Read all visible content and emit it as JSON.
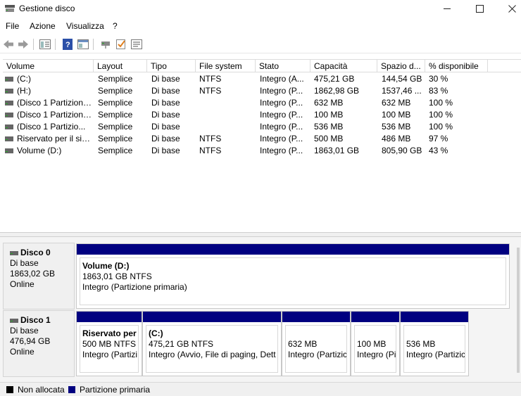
{
  "window": {
    "title": "Gestione disco",
    "controls": {
      "minimize": "—",
      "maximize": "☐",
      "close": "✕"
    }
  },
  "menu": [
    "File",
    "Azione",
    "Visualizza",
    "?"
  ],
  "toolbar": [
    "back-icon",
    "forward-icon",
    "properties-icon",
    "help-icon",
    "toggle-pane-icon",
    "connect-icon",
    "check-icon",
    "settings-icon"
  ],
  "columns": [
    "Volume",
    "Layout",
    "Tipo",
    "File system",
    "Stato",
    "Capacità",
    "Spazio d...",
    "% disponibile"
  ],
  "volumes": [
    [
      "(C:)",
      "Semplice",
      "Di base",
      "NTFS",
      "Integro (A...",
      "475,21 GB",
      "144,54 GB",
      "30 %"
    ],
    [
      "(H:)",
      "Semplice",
      "Di base",
      "NTFS",
      "Integro (P...",
      "1862,98 GB",
      "1537,46 ...",
      "83 %"
    ],
    [
      "(Disco 1 Partizione...",
      "Semplice",
      "Di base",
      "",
      "Integro (P...",
      "632 MB",
      "632 MB",
      "100 %"
    ],
    [
      "(Disco 1 Partizione...",
      "Semplice",
      "Di base",
      "",
      "Integro (P...",
      "100 MB",
      "100 MB",
      "100 %"
    ],
    [
      "(Disco 1 Partizio...",
      "Semplice",
      "Di base",
      "",
      "Integro (P...",
      "536 MB",
      "536 MB",
      "100 %"
    ],
    [
      "Riservato per il sist...",
      "Semplice",
      "Di base",
      "NTFS",
      "Integro (P...",
      "500 MB",
      "486 MB",
      "97 %"
    ],
    [
      "Volume (D:)",
      "Semplice",
      "Di base",
      "NTFS",
      "Integro (P...",
      "1863,01 GB",
      "805,90 GB",
      "43 %"
    ]
  ],
  "disks": [
    {
      "name": "Disco 0",
      "type": "Di base",
      "size": "1863,02 GB",
      "status": "Online",
      "partitions": [
        {
          "title": "Volume  (D:)",
          "size": "1863,01 GB NTFS",
          "status": "Integro (Partizione primaria)"
        }
      ]
    },
    {
      "name": "Disco 1",
      "type": "Di base",
      "size": "476,94 GB",
      "status": "Online",
      "partitions": [
        {
          "title": "Riservato per",
          "size": "500 MB NTFS",
          "status": "Integro (Partizi"
        },
        {
          "title": "(C:)",
          "size": "475,21 GB NTFS",
          "status": "Integro (Avvio, File di paging, Dett"
        },
        {
          "title": "",
          "size": "632 MB",
          "status": "Integro (Partizic"
        },
        {
          "title": "",
          "size": "100 MB",
          "status": "Integro (Pi"
        },
        {
          "title": "",
          "size": "536 MB",
          "status": "Integro (Partizic"
        }
      ]
    }
  ],
  "legend": [
    {
      "label": "Non allocata",
      "color": "#000000"
    },
    {
      "label": "Partizione primaria",
      "color": "#000080"
    }
  ]
}
